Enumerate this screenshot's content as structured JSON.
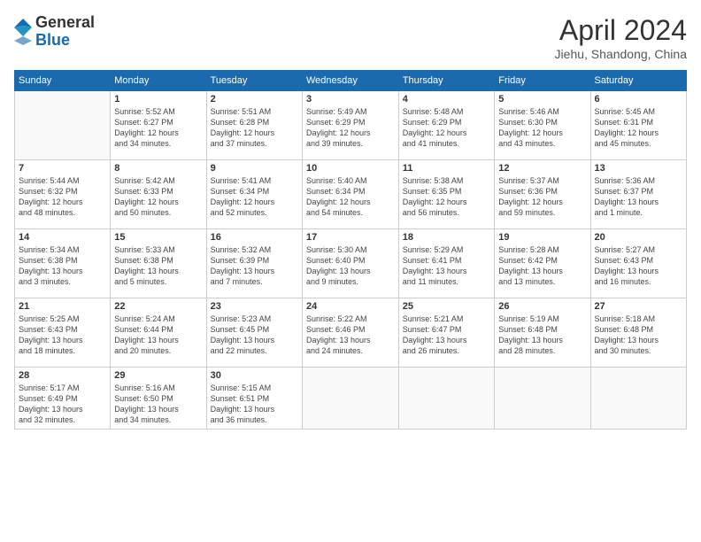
{
  "header": {
    "logo_general": "General",
    "logo_blue": "Blue",
    "month_title": "April 2024",
    "location": "Jiehu, Shandong, China"
  },
  "weekdays": [
    "Sunday",
    "Monday",
    "Tuesday",
    "Wednesday",
    "Thursday",
    "Friday",
    "Saturday"
  ],
  "weeks": [
    [
      {
        "day": "",
        "info": ""
      },
      {
        "day": "1",
        "info": "Sunrise: 5:52 AM\nSunset: 6:27 PM\nDaylight: 12 hours\nand 34 minutes."
      },
      {
        "day": "2",
        "info": "Sunrise: 5:51 AM\nSunset: 6:28 PM\nDaylight: 12 hours\nand 37 minutes."
      },
      {
        "day": "3",
        "info": "Sunrise: 5:49 AM\nSunset: 6:29 PM\nDaylight: 12 hours\nand 39 minutes."
      },
      {
        "day": "4",
        "info": "Sunrise: 5:48 AM\nSunset: 6:29 PM\nDaylight: 12 hours\nand 41 minutes."
      },
      {
        "day": "5",
        "info": "Sunrise: 5:46 AM\nSunset: 6:30 PM\nDaylight: 12 hours\nand 43 minutes."
      },
      {
        "day": "6",
        "info": "Sunrise: 5:45 AM\nSunset: 6:31 PM\nDaylight: 12 hours\nand 45 minutes."
      }
    ],
    [
      {
        "day": "7",
        "info": "Sunrise: 5:44 AM\nSunset: 6:32 PM\nDaylight: 12 hours\nand 48 minutes."
      },
      {
        "day": "8",
        "info": "Sunrise: 5:42 AM\nSunset: 6:33 PM\nDaylight: 12 hours\nand 50 minutes."
      },
      {
        "day": "9",
        "info": "Sunrise: 5:41 AM\nSunset: 6:34 PM\nDaylight: 12 hours\nand 52 minutes."
      },
      {
        "day": "10",
        "info": "Sunrise: 5:40 AM\nSunset: 6:34 PM\nDaylight: 12 hours\nand 54 minutes."
      },
      {
        "day": "11",
        "info": "Sunrise: 5:38 AM\nSunset: 6:35 PM\nDaylight: 12 hours\nand 56 minutes."
      },
      {
        "day": "12",
        "info": "Sunrise: 5:37 AM\nSunset: 6:36 PM\nDaylight: 12 hours\nand 59 minutes."
      },
      {
        "day": "13",
        "info": "Sunrise: 5:36 AM\nSunset: 6:37 PM\nDaylight: 13 hours\nand 1 minute."
      }
    ],
    [
      {
        "day": "14",
        "info": "Sunrise: 5:34 AM\nSunset: 6:38 PM\nDaylight: 13 hours\nand 3 minutes."
      },
      {
        "day": "15",
        "info": "Sunrise: 5:33 AM\nSunset: 6:38 PM\nDaylight: 13 hours\nand 5 minutes."
      },
      {
        "day": "16",
        "info": "Sunrise: 5:32 AM\nSunset: 6:39 PM\nDaylight: 13 hours\nand 7 minutes."
      },
      {
        "day": "17",
        "info": "Sunrise: 5:30 AM\nSunset: 6:40 PM\nDaylight: 13 hours\nand 9 minutes."
      },
      {
        "day": "18",
        "info": "Sunrise: 5:29 AM\nSunset: 6:41 PM\nDaylight: 13 hours\nand 11 minutes."
      },
      {
        "day": "19",
        "info": "Sunrise: 5:28 AM\nSunset: 6:42 PM\nDaylight: 13 hours\nand 13 minutes."
      },
      {
        "day": "20",
        "info": "Sunrise: 5:27 AM\nSunset: 6:43 PM\nDaylight: 13 hours\nand 16 minutes."
      }
    ],
    [
      {
        "day": "21",
        "info": "Sunrise: 5:25 AM\nSunset: 6:43 PM\nDaylight: 13 hours\nand 18 minutes."
      },
      {
        "day": "22",
        "info": "Sunrise: 5:24 AM\nSunset: 6:44 PM\nDaylight: 13 hours\nand 20 minutes."
      },
      {
        "day": "23",
        "info": "Sunrise: 5:23 AM\nSunset: 6:45 PM\nDaylight: 13 hours\nand 22 minutes."
      },
      {
        "day": "24",
        "info": "Sunrise: 5:22 AM\nSunset: 6:46 PM\nDaylight: 13 hours\nand 24 minutes."
      },
      {
        "day": "25",
        "info": "Sunrise: 5:21 AM\nSunset: 6:47 PM\nDaylight: 13 hours\nand 26 minutes."
      },
      {
        "day": "26",
        "info": "Sunrise: 5:19 AM\nSunset: 6:48 PM\nDaylight: 13 hours\nand 28 minutes."
      },
      {
        "day": "27",
        "info": "Sunrise: 5:18 AM\nSunset: 6:48 PM\nDaylight: 13 hours\nand 30 minutes."
      }
    ],
    [
      {
        "day": "28",
        "info": "Sunrise: 5:17 AM\nSunset: 6:49 PM\nDaylight: 13 hours\nand 32 minutes."
      },
      {
        "day": "29",
        "info": "Sunrise: 5:16 AM\nSunset: 6:50 PM\nDaylight: 13 hours\nand 34 minutes."
      },
      {
        "day": "30",
        "info": "Sunrise: 5:15 AM\nSunset: 6:51 PM\nDaylight: 13 hours\nand 36 minutes."
      },
      {
        "day": "",
        "info": ""
      },
      {
        "day": "",
        "info": ""
      },
      {
        "day": "",
        "info": ""
      },
      {
        "day": "",
        "info": ""
      }
    ]
  ]
}
